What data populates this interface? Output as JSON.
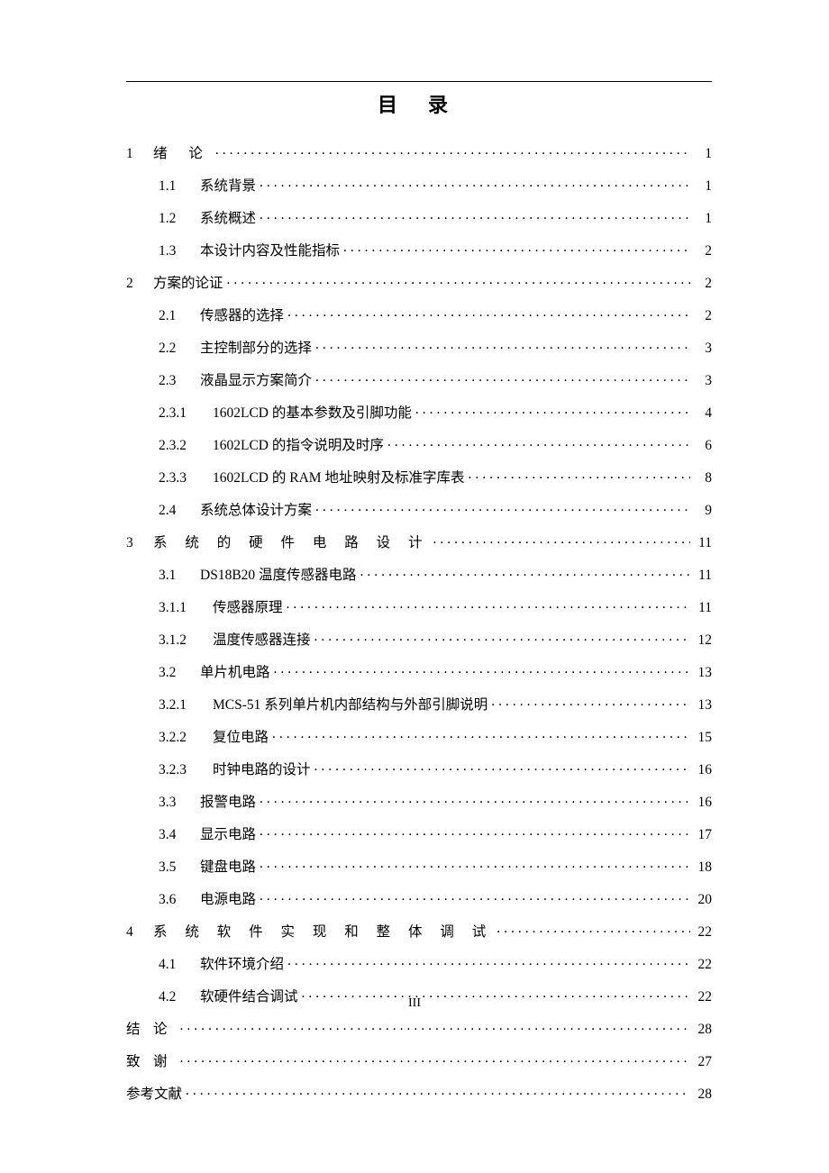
{
  "title": "目 录",
  "footer": "III",
  "toc": [
    {
      "level": 1,
      "num": "1",
      "label": "绪  论",
      "page": "1",
      "spaced": "spaced-2"
    },
    {
      "level": 2,
      "num": "1.1",
      "label": "系统背景",
      "page": "1"
    },
    {
      "level": 2,
      "num": "1.2",
      "label": "系统概述",
      "page": "1"
    },
    {
      "level": 2,
      "num": "1.3",
      "label": "本设计内容及性能指标",
      "page": "2"
    },
    {
      "level": 1,
      "num": "2",
      "label": "方案的论证",
      "page": "2"
    },
    {
      "level": 2,
      "num": "2.1",
      "label": "传感器的选择",
      "page": "2"
    },
    {
      "level": 2,
      "num": "2.2",
      "label": "主控制部分的选择",
      "page": "3"
    },
    {
      "level": 2,
      "num": "2.3",
      "label": "液晶显示方案简介",
      "page": "3"
    },
    {
      "level": 3,
      "num": "2.3.1",
      "label": "1602LCD 的基本参数及引脚功能",
      "page": "4"
    },
    {
      "level": 3,
      "num": "2.3.2",
      "label": "1602LCD 的指令说明及时序",
      "page": "6"
    },
    {
      "level": 3,
      "num": "2.3.3",
      "label": "1602LCD 的 RAM 地址映射及标准字库表",
      "page": "8"
    },
    {
      "level": 2,
      "num": "2.4",
      "label": "系统总体设计方案",
      "page": "9"
    },
    {
      "level": 1,
      "num": "3",
      "label": "系 统 的 硬 件 电 路 设 计",
      "page": "11",
      "spaced": "spaced-wide"
    },
    {
      "level": 2,
      "num": "3.1",
      "label": "DS18B20 温度传感器电路",
      "page": "11"
    },
    {
      "level": 3,
      "num": "3.1.1",
      "label": "传感器原理",
      "page": "11"
    },
    {
      "level": 3,
      "num": "3.1.2",
      "label": "温度传感器连接",
      "page": "12"
    },
    {
      "level": 2,
      "num": "3.2",
      "label": "单片机电路",
      "page": "13"
    },
    {
      "level": 3,
      "num": "3.2.1",
      "label": "MCS-51 系列单片机内部结构与外部引脚说明",
      "page": "13"
    },
    {
      "level": 3,
      "num": "3.2.2",
      "label": "复位电路",
      "page": "15"
    },
    {
      "level": 3,
      "num": "3.2.3",
      "label": "时钟电路的设计",
      "page": "16"
    },
    {
      "level": 2,
      "num": "3.3",
      "label": "报警电路",
      "page": "16"
    },
    {
      "level": 2,
      "num": "3.4",
      "label": "显示电路",
      "page": "17"
    },
    {
      "level": 2,
      "num": "3.5",
      "label": "键盘电路",
      "page": "18"
    },
    {
      "level": 2,
      "num": "3.6",
      "label": "电源电路",
      "page": "20"
    },
    {
      "level": 1,
      "num": "4",
      "label": "系 统 软 件 实 现 和 整 体 调 试",
      "page": "22",
      "spaced": "spaced-wide"
    },
    {
      "level": 2,
      "num": "4.1",
      "label": "软件环境介绍",
      "page": "22"
    },
    {
      "level": 2,
      "num": "4.2",
      "label": "软硬件结合调试",
      "page": "22"
    },
    {
      "level": 1,
      "num": "结",
      "label": "论",
      "page": "28",
      "spaced": "spaced-2",
      "numwide": true
    },
    {
      "level": 1,
      "num": "致",
      "label": "谢",
      "page": "27",
      "spaced": "spaced-2",
      "numwide": true
    },
    {
      "level": 1,
      "num": "",
      "label": "参考文献",
      "page": "28",
      "nonum": true
    }
  ]
}
